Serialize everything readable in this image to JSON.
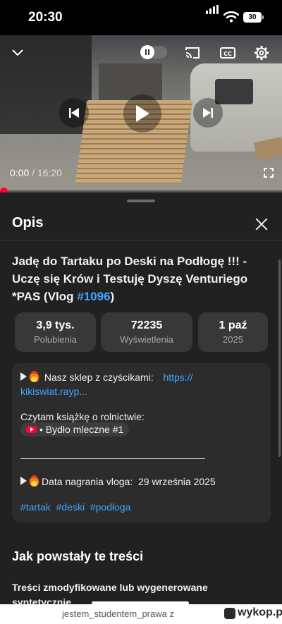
{
  "status_bar": {
    "time": "20:30",
    "battery": "30"
  },
  "player": {
    "current_time": "0:00",
    "separator": " / ",
    "duration": "16:20",
    "progress_fraction": 0.0
  },
  "panel": {
    "title": "Opis",
    "video_title_before_tag": "Jadę do Tartaku po Deski na Podłogę !!! - Uczę się Krów i Testuję Dyszę Venturiego *PAS (Vlog ",
    "video_title_tag": "#1096",
    "video_title_after_tag": ")",
    "stats": [
      {
        "value": "3,9 tys.",
        "label": "Polubienia"
      },
      {
        "value": "72235",
        "label": "Wyświetlenia"
      },
      {
        "value": "1 paź",
        "label": "2025"
      }
    ],
    "description": {
      "shop_text": "Nasz sklep z czyścikami: ",
      "shop_link": "https:// kikiswiat.rayp...",
      "book_text": "Czytam książkę o rolnictwie:",
      "book_chip": "• Bydło mleczne #1",
      "recording_label": "Data nagrania vloga:",
      "recording_date": "29 września 2025",
      "hashtags": [
        "#tartak",
        "#deski",
        "#podłoga"
      ]
    },
    "section": {
      "title": "Jak powstały te treści",
      "body": "Treści zmodyfikowane lub wygenerowane syntetycznie"
    }
  },
  "watermark": {
    "user": "jestem_studentem_prawa z",
    "site": "wykop.pl"
  },
  "icons": [
    "chevron-down-icon",
    "pause-toggle-icon",
    "cast-icon",
    "captions-icon",
    "settings-gear-icon",
    "previous-icon",
    "play-icon",
    "next-icon",
    "fullscreen-icon",
    "close-icon",
    "fire-icon",
    "play-triangle-icon",
    "youtube-icon"
  ]
}
